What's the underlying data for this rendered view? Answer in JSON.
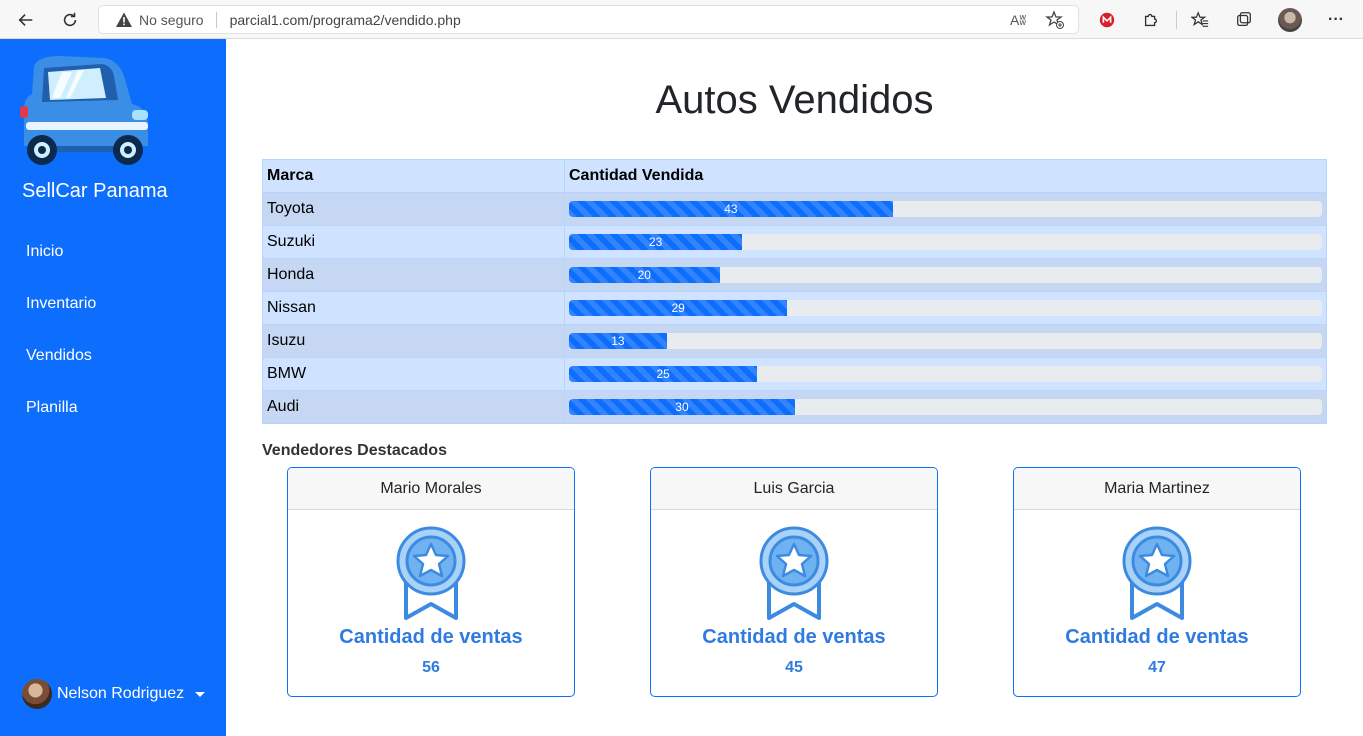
{
  "browser": {
    "not_secure_label": "No seguro",
    "url": "parcial1.com/programa2/vendido.php",
    "read_aloud_label": "Aʬ",
    "more_label": "···"
  },
  "sidebar": {
    "brand": "SellCar Panama",
    "links": [
      {
        "label": "Inicio"
      },
      {
        "label": "Inventario"
      },
      {
        "label": "Vendidos"
      },
      {
        "label": "Planilla"
      }
    ],
    "user_name": "Nelson Rodriguez",
    "accent_color": "#0d6efd"
  },
  "main": {
    "title": "Autos Vendidos",
    "table": {
      "headers": [
        "Marca",
        "Cantidad Vendida"
      ],
      "max_value": 100,
      "rows": [
        {
          "brand": "Toyota",
          "sold": 43
        },
        {
          "brand": "Suzuki",
          "sold": 23
        },
        {
          "brand": "Honda",
          "sold": 20
        },
        {
          "brand": "Nissan",
          "sold": 29
        },
        {
          "brand": "Isuzu",
          "sold": 13
        },
        {
          "brand": "BMW",
          "sold": 25
        },
        {
          "brand": "Audi",
          "sold": 30
        }
      ]
    },
    "featured_title": "Vendedores Destacados",
    "sellers": [
      {
        "name": "Mario Morales",
        "label": "Cantidad de ventas",
        "sales": "56"
      },
      {
        "name": "Luis Garcia",
        "label": "Cantidad de ventas",
        "sales": "45"
      },
      {
        "name": "Maria Martinez",
        "label": "Cantidad de ventas",
        "sales": "47"
      }
    ]
  }
}
